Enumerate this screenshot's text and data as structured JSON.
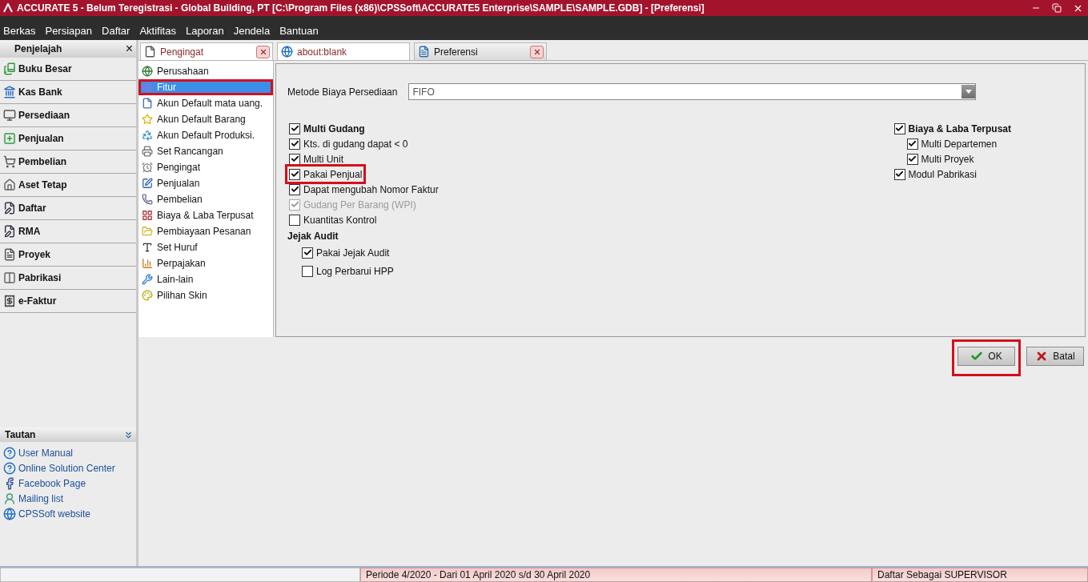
{
  "window": {
    "title": "ACCURATE 5  - Belum Teregistrasi - Global Building, PT   [C:\\Program Files (x86)\\CPSSoft\\ACCURATE5 Enterprise\\SAMPLE\\SAMPLE.GDB] - [Preferensi]"
  },
  "menu": [
    "Berkas",
    "Persiapan",
    "Daftar",
    "Aktifitas",
    "Laporan",
    "Jendela",
    "Bantuan"
  ],
  "explorer": {
    "title": "Penjelajah",
    "close": "×",
    "items": [
      {
        "label": "Buku Besar",
        "kind": "ledger"
      },
      {
        "label": "Kas Bank",
        "kind": "bank"
      },
      {
        "label": "Persediaan",
        "kind": "inventory"
      },
      {
        "label": "Penjualan",
        "kind": "sales"
      },
      {
        "label": "Pembelian",
        "kind": "purchase"
      },
      {
        "label": "Aset Tetap",
        "kind": "asset"
      },
      {
        "label": "Daftar",
        "kind": "list"
      },
      {
        "label": "RMA",
        "kind": "list"
      },
      {
        "label": "Proyek",
        "kind": "project"
      },
      {
        "label": "Pabrikasi",
        "kind": "factory"
      },
      {
        "label": "e-Faktur",
        "kind": "invoice"
      }
    ]
  },
  "links": {
    "title": "Tautan",
    "items": [
      {
        "label": "User Manual",
        "kind": "help"
      },
      {
        "label": "Online Solution Center",
        "kind": "help"
      },
      {
        "label": "Facebook Page",
        "kind": "facebook"
      },
      {
        "label": "Mailing list",
        "kind": "mail"
      },
      {
        "label": "CPSSoft website",
        "kind": "web"
      }
    ]
  },
  "tabs": [
    {
      "label": "Pengingat",
      "selected": false,
      "closable": true,
      "kind": "doc"
    },
    {
      "label": "about:blank",
      "selected": false,
      "closable": false,
      "kind": "web"
    },
    {
      "label": "Preferensi",
      "selected": true,
      "closable": true,
      "kind": "form"
    }
  ],
  "categories": [
    {
      "label": "Perusahaan",
      "selected": false,
      "highlighted": false,
      "kind": "globe"
    },
    {
      "label": "Fitur",
      "selected": true,
      "highlighted": true,
      "kind": "gear"
    },
    {
      "label": "Akun Default mata uang.",
      "selected": false,
      "highlighted": false,
      "kind": "doc"
    },
    {
      "label": "Akun Default Barang",
      "selected": false,
      "highlighted": false,
      "kind": "star"
    },
    {
      "label": "Akun Default Produksi.",
      "selected": false,
      "highlighted": false,
      "kind": "recycle"
    },
    {
      "label": "Set Rancangan",
      "selected": false,
      "highlighted": false,
      "kind": "printer"
    },
    {
      "label": "Pengingat",
      "selected": false,
      "highlighted": false,
      "kind": "clock"
    },
    {
      "label": "Penjualan",
      "selected": false,
      "highlighted": false,
      "kind": "edit"
    },
    {
      "label": "Pembelian",
      "selected": false,
      "highlighted": false,
      "kind": "phone"
    },
    {
      "label": "Biaya & Laba Terpusat",
      "selected": false,
      "highlighted": false,
      "kind": "grid"
    },
    {
      "label": "Pembiayaan Pesanan",
      "selected": false,
      "highlighted": false,
      "kind": "folder"
    },
    {
      "label": "Set Huruf",
      "selected": false,
      "highlighted": false,
      "kind": "font"
    },
    {
      "label": "Perpajakan",
      "selected": false,
      "highlighted": false,
      "kind": "chart"
    },
    {
      "label": "Lain-lain",
      "selected": false,
      "highlighted": false,
      "kind": "tool"
    },
    {
      "label": "Pilihan Skin",
      "selected": false,
      "highlighted": false,
      "kind": "palette"
    }
  ],
  "cost_method": {
    "label": "Metode Biaya Persediaan",
    "value": "FIFO"
  },
  "options_left": [
    {
      "label": "Multi Gudang",
      "checked": true,
      "disabled": false,
      "highlighted": false,
      "kind": "header"
    },
    {
      "label": "Kts. di gudang dapat < 0",
      "checked": true,
      "disabled": false,
      "highlighted": false,
      "kind": "item"
    },
    {
      "label": "Multi Unit",
      "checked": true,
      "disabled": false,
      "highlighted": false,
      "kind": "item"
    },
    {
      "label": "Pakai Penjual",
      "checked": true,
      "disabled": false,
      "highlighted": true,
      "kind": "item"
    },
    {
      "label": "Dapat mengubah Nomor Faktur",
      "checked": true,
      "disabled": false,
      "highlighted": false,
      "kind": "item"
    },
    {
      "label": "Gudang Per Barang (WPI)",
      "checked": true,
      "disabled": true,
      "highlighted": false,
      "kind": "item"
    },
    {
      "label": "Kuantitas Kontrol",
      "checked": false,
      "disabled": false,
      "highlighted": false,
      "kind": "item"
    }
  ],
  "audit": {
    "title": "Jejak Audit",
    "items": [
      {
        "label": "Pakai Jejak Audit",
        "checked": true,
        "disabled": false,
        "highlighted": false,
        "kind": "sub"
      },
      {
        "label": "Log Perbarui HPP",
        "checked": false,
        "disabled": false,
        "highlighted": false,
        "kind": "sub"
      }
    ]
  },
  "options_right": [
    {
      "label": "Biaya & Laba Terpusat",
      "checked": true,
      "disabled": false,
      "highlighted": false,
      "kind": "header"
    },
    {
      "label": "Multi Departemen",
      "checked": true,
      "disabled": false,
      "highlighted": false,
      "kind": "sub"
    },
    {
      "label": "Multi Proyek",
      "checked": true,
      "disabled": false,
      "highlighted": false,
      "kind": "sub"
    },
    {
      "label": "Modul Pabrikasi",
      "checked": true,
      "disabled": false,
      "highlighted": false,
      "kind": "item"
    }
  ],
  "buttons": [
    {
      "label": "OK",
      "kind": "ok",
      "highlighted": true
    },
    {
      "label": "Batal",
      "kind": "cancel",
      "highlighted": false
    }
  ],
  "status_bar": {
    "period": "Periode 4/2020 - Dari 01 April 2020 s/d 30 April 2020",
    "user": "Daftar Sebagai SUPERVISOR"
  }
}
